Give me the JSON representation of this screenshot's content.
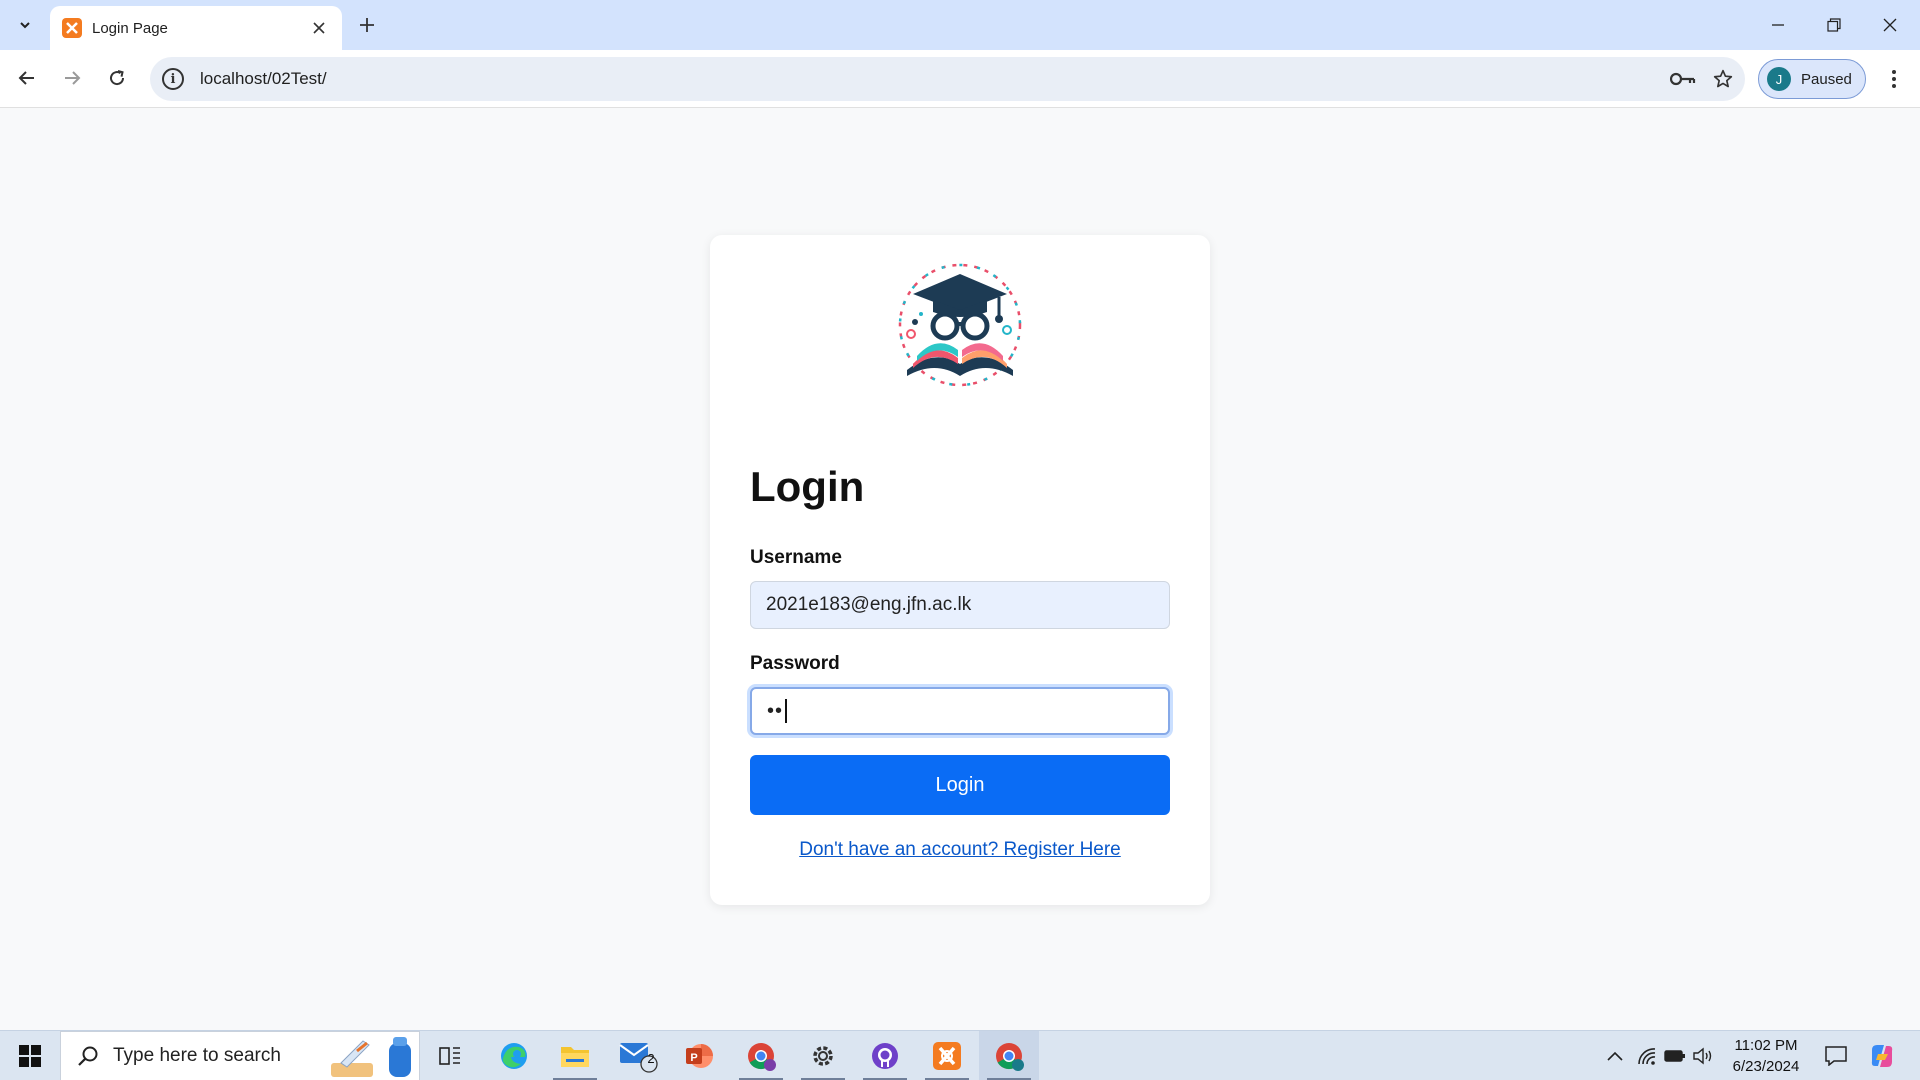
{
  "browser": {
    "tab_title": "Login Page",
    "url": "localhost/02Test/",
    "profile_initial": "J",
    "profile_status": "Paused"
  },
  "page": {
    "heading": "Login",
    "username_label": "Username",
    "username_value": "2021e183@eng.jfn.ac.lk",
    "password_label": "Password",
    "password_value": "••",
    "login_button": "Login",
    "register_link": "Don't have an account? Register Here"
  },
  "taskbar": {
    "search_placeholder": "Type here to search",
    "mail_badge": "2",
    "time": "11:02 PM",
    "date": "6/23/2024"
  },
  "colors": {
    "primary_button": "#0a6cf5",
    "link": "#0a58ca",
    "tabbar": "#d3e3fd",
    "page_bg": "#f8f9fa"
  },
  "icons": [
    "tab-search-icon",
    "xampp-icon",
    "close-icon",
    "plus-icon",
    "minimize-icon",
    "restore-icon",
    "back-icon",
    "forward-icon",
    "reload-icon",
    "info-icon",
    "password-key-icon",
    "star-icon",
    "more-icon",
    "windows-icon",
    "search-icon",
    "task-view-icon",
    "edge-icon",
    "file-explorer-icon",
    "mail-icon",
    "powerpoint-icon",
    "chrome-icon",
    "settings-icon",
    "github-icon",
    "chevron-up-icon",
    "wifi-icon",
    "battery-icon",
    "volume-icon",
    "notification-icon",
    "copilot-icon"
  ]
}
